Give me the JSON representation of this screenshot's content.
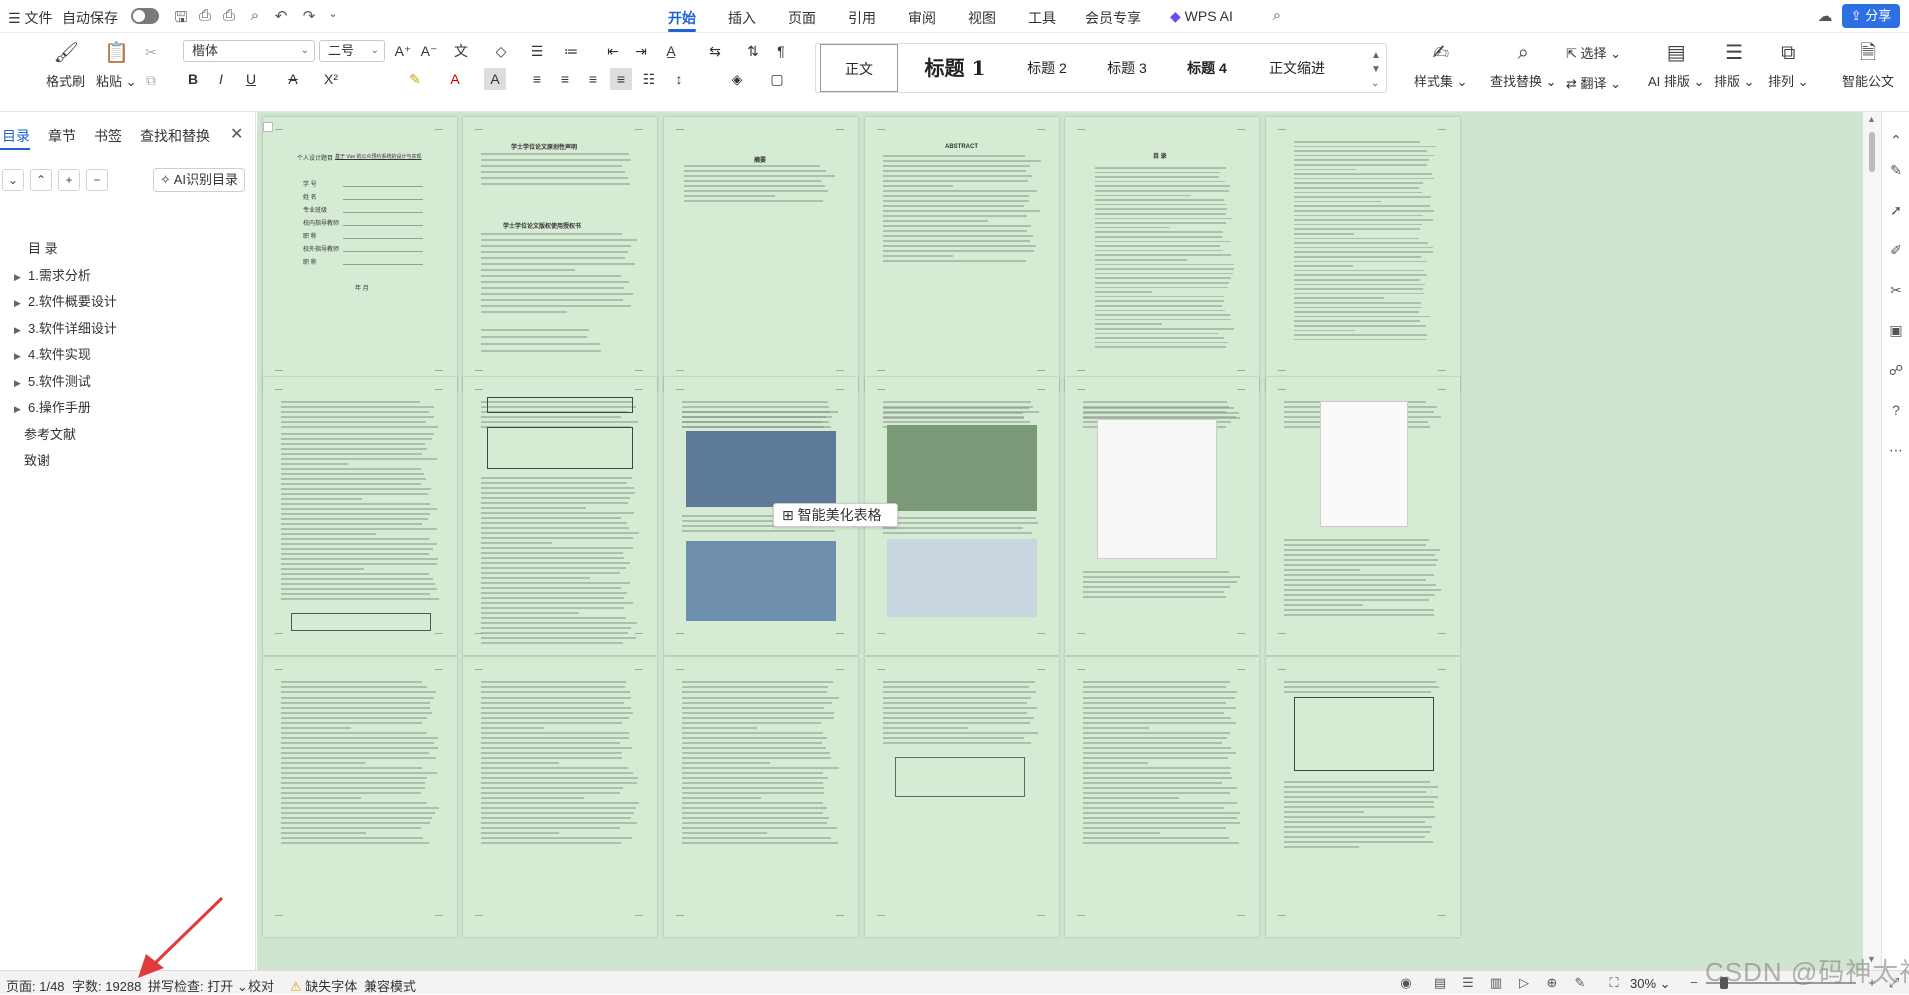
{
  "menubar": {
    "file": "文件",
    "autosave": "自动保存",
    "tabs": [
      "开始",
      "插入",
      "页面",
      "引用",
      "审阅",
      "视图",
      "工具",
      "会员专享"
    ],
    "active_tab": "开始",
    "wps_ai": "WPS AI",
    "share": "分享"
  },
  "toolbar": {
    "format_painter": "格式刷",
    "paste": "粘贴",
    "font_family": "楷体",
    "font_size": "二号",
    "styles": [
      "正文",
      "标题 1",
      "标题 2",
      "标题 3",
      "标题 4",
      "正文缩进"
    ],
    "styles_set": "样式集",
    "find_replace": "查找替换",
    "select": "选择",
    "translate": "翻译",
    "ai_layout": "AI 排版",
    "layout": "排版",
    "arrange": "排列",
    "smart_doc": "智能公文"
  },
  "sidebar": {
    "tabs": [
      "目录",
      "章节",
      "书签",
      "查找和替换"
    ],
    "ai_toc": "AI识别目录",
    "toc": [
      {
        "label": "目  录",
        "expandable": false
      },
      {
        "label": "1.需求分析",
        "expandable": true
      },
      {
        "label": "2.软件概要设计",
        "expandable": true
      },
      {
        "label": "3.软件详细设计",
        "expandable": true
      },
      {
        "label": "4.软件实现",
        "expandable": true
      },
      {
        "label": "5.软件测试",
        "expandable": true
      },
      {
        "label": "6.操作手册",
        "expandable": true
      },
      {
        "label": "参考文献",
        "expandable": false
      },
      {
        "label": "致谢",
        "expandable": false
      }
    ]
  },
  "document": {
    "floating_button": "智能美化表格",
    "cover": {
      "title_label": "个人设计题目",
      "title_value": "基于 Vue 的公众预约系统的设计与实现",
      "fields": [
        "学    号",
        "姓    名",
        "专业班级",
        "校内指导教师",
        "职    称",
        "校外指导教师",
        "职    称"
      ],
      "date": "年   月"
    },
    "page2_title": "学士学位论文原创性声明",
    "page2_title2": "学士学位论文版权使用授权书",
    "abstract_cn_title": "摘要",
    "abstract_en_title": "ABSTRACT",
    "toc_title": "目  录"
  },
  "statusbar": {
    "page": "页面: 1/48",
    "word_count": "字数: 19288",
    "spell_check": "拼写检查: 打开",
    "proofread": "校对",
    "missing_font": "缺失字体",
    "compat_mode": "兼容模式",
    "zoom": "30%"
  },
  "watermark": "CSDN @码神太神",
  "colors": {
    "accent": "#1e63d6",
    "doc_bg": "#cfe5cf",
    "page_bg": "#d6ebd4",
    "arrow": "#e03b3b"
  }
}
